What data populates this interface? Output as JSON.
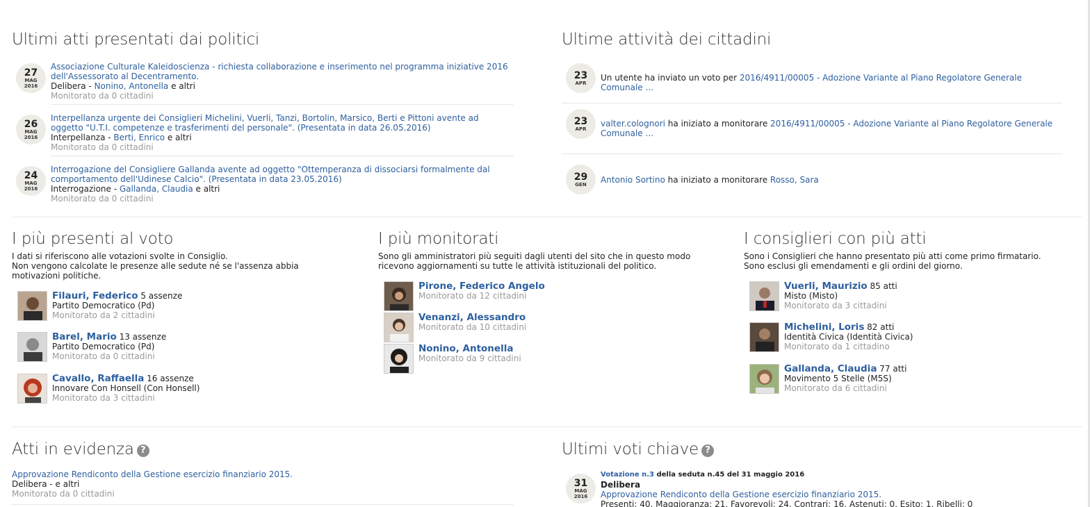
{
  "left_top": {
    "title": "Ultimi atti presentati dai politici",
    "items": [
      {
        "day": "27",
        "month": "MAG",
        "year": "2016",
        "title": "Associazione Culturale Kaleidoscienza - richiesta collaborazione e inserimento nel programma iniziative 2016 dell'Assessorato al Decentramento.",
        "type": "Delibera - ",
        "author": "Nonino, Antonella",
        "others": " e altri",
        "monitor": "Monitorato da 0 cittadini"
      },
      {
        "day": "26",
        "month": "MAG",
        "year": "2016",
        "title": "Interpellanza urgente dei Consiglieri Michelini, Vuerli, Tanzi, Bortolin, Marsico, Berti e Pittoni avente ad oggetto \"U.T.I. competenze e trasferimenti del personale\". (Presentata in data 26.05.2016)",
        "type": "Interpellanza - ",
        "author": "Berti, Enrico",
        "others": " e altri",
        "monitor": "Monitorato da 0 cittadini"
      },
      {
        "day": "24",
        "month": "MAG",
        "year": "2016",
        "title": "Interrogazione del Consigliere Gallanda avente ad oggetto \"Ottemperanza di dissociarsi formalmente dal comportamento dell'Udinese Calcio\". (Presentata in data 23.05.2016)",
        "type": "Interrogazione - ",
        "author": "Gallanda, Claudia",
        "others": " e altri",
        "monitor": "Monitorato da 0 cittadini"
      }
    ]
  },
  "right_top": {
    "title": "Ultime attività dei cittadini",
    "items": [
      {
        "day": "23",
        "month": "APR",
        "actor": "",
        "text": "Un utente ha inviato un voto per ",
        "target": "2016/4911/00005 - Adozione Variante al Piano Regolatore Generale Comunale ..."
      },
      {
        "day": "23",
        "month": "APR",
        "actor": "valter.colognori",
        "text": " ha iniziato a monitorare ",
        "target": "2016/4911/00005 - Adozione Variante al Piano Regolatore Generale Comunale ..."
      },
      {
        "day": "29",
        "month": "GEN",
        "actor": "Antonio Sortino",
        "text": " ha iniziato a monitorare ",
        "target": "Rosso, Sara"
      }
    ]
  },
  "presenti": {
    "title": "I più presenti al voto",
    "desc1": "I dati si riferiscono alle votazioni svolte in Consiglio.",
    "desc2": "Non vengono calcolate le presenze alle sedute né se l'assenza abbia motivazioni politiche.",
    "items": [
      {
        "name": "Filauri, Federico",
        "stat": " 5 assenze",
        "party": "Partito Democratico (Pd)",
        "monitor": "Monitorato da 2 cittadini"
      },
      {
        "name": "Barel, Mario",
        "stat": " 13 assenze",
        "party": "Partito Democratico (Pd)",
        "monitor": "Monitorato da 0 cittadini"
      },
      {
        "name": "Cavallo, Raffaella",
        "stat": " 16 assenze",
        "party": "Innovare Con Honsell (Con Honsell)",
        "monitor": "Monitorato da 3 cittadini"
      }
    ]
  },
  "monitorati": {
    "title": "I più monitorati",
    "desc1": "Sono gli amministratori più seguiti dagli utenti del sito che in questo modo ricevono aggiornamenti su tutte le attività istituzionali del politico.",
    "items": [
      {
        "name": "Pirone, Federico Angelo",
        "monitor": "Monitorato da 12 cittadini"
      },
      {
        "name": "Venanzi, Alessandro",
        "monitor": "Monitorato da 10 cittadini"
      },
      {
        "name": "Nonino, Antonella",
        "monitor": "Monitorato da 9 cittadini"
      }
    ]
  },
  "consiglieri": {
    "title": "I consiglieri con più atti",
    "desc1": "Sono i Consiglieri che hanno presentato più atti come primo firmatario.",
    "desc2": "Sono esclusi gli emendamenti e gli ordini del giorno.",
    "items": [
      {
        "name": "Vuerli, Maurizio",
        "stat": " 85 atti",
        "party": "Misto (Misto)",
        "monitor": "Monitorato da 3 cittadini"
      },
      {
        "name": "Michelini, Loris",
        "stat": " 82 atti",
        "party": "Identità Civica (Identità Civica)",
        "monitor": "Monitorato da 1 cittadino"
      },
      {
        "name": "Gallanda, Claudia",
        "stat": " 77 atti",
        "party": "Movimento 5 Stelle (M5S)",
        "monitor": "Monitorato da 6 cittadini"
      }
    ]
  },
  "evidenza": {
    "title": "Atti in evidenza",
    "help": "?",
    "item_title": "Approvazione Rendiconto della Gestione esercizio finanziario 2015.",
    "item_type": "Delibera - e altri",
    "item_monitor": "Monitorato da 0 cittadini"
  },
  "voti": {
    "title": "Ultimi voti chiave",
    "help": "?",
    "day": "31",
    "month": "MAG",
    "year": "2016",
    "vote_link": "Votazione n.3",
    "vote_rest": " della seduta n.45 del 31 maggio 2016",
    "vote_type": "Delibera",
    "vote_title": "Approvazione Rendiconto della Gestione esercizio finanziario 2015.",
    "vote_stats": "Presenti: 40, Maggioranza: 21, Favorevoli: 24, Contrari: 16, Astenuti: 0, Esito: 1, Ribelli: 0"
  }
}
